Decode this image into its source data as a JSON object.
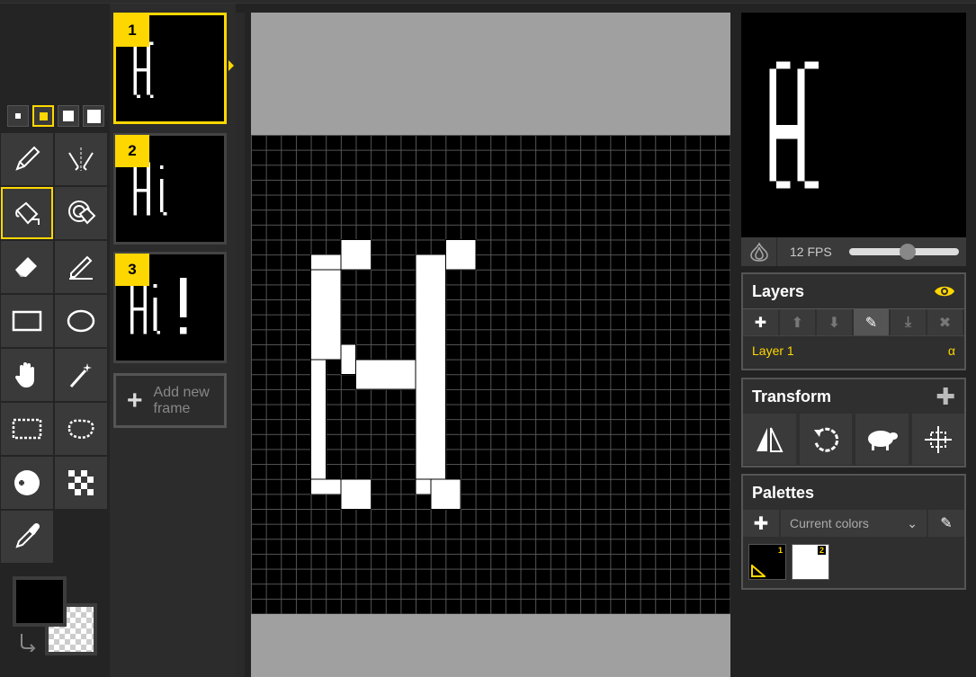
{
  "frames": [
    {
      "number": "1"
    },
    {
      "number": "2"
    },
    {
      "number": "3"
    }
  ],
  "add_frame_label_1": "Add new",
  "add_frame_label_2": "frame",
  "preview": {
    "fps_label": "12 FPS",
    "fps_fraction": 0.5
  },
  "layers": {
    "title": "Layers",
    "layer_name": "Layer 1",
    "alpha_symbol": "α"
  },
  "transform": {
    "title": "Transform"
  },
  "palettes": {
    "title": "Palettes",
    "selected": "Current colors",
    "swatches": [
      {
        "number": "1",
        "color": "#000000"
      },
      {
        "number": "2",
        "color": "#ffffff"
      }
    ]
  },
  "colors": {
    "primary": "#000000",
    "accent": "#ffd700"
  }
}
